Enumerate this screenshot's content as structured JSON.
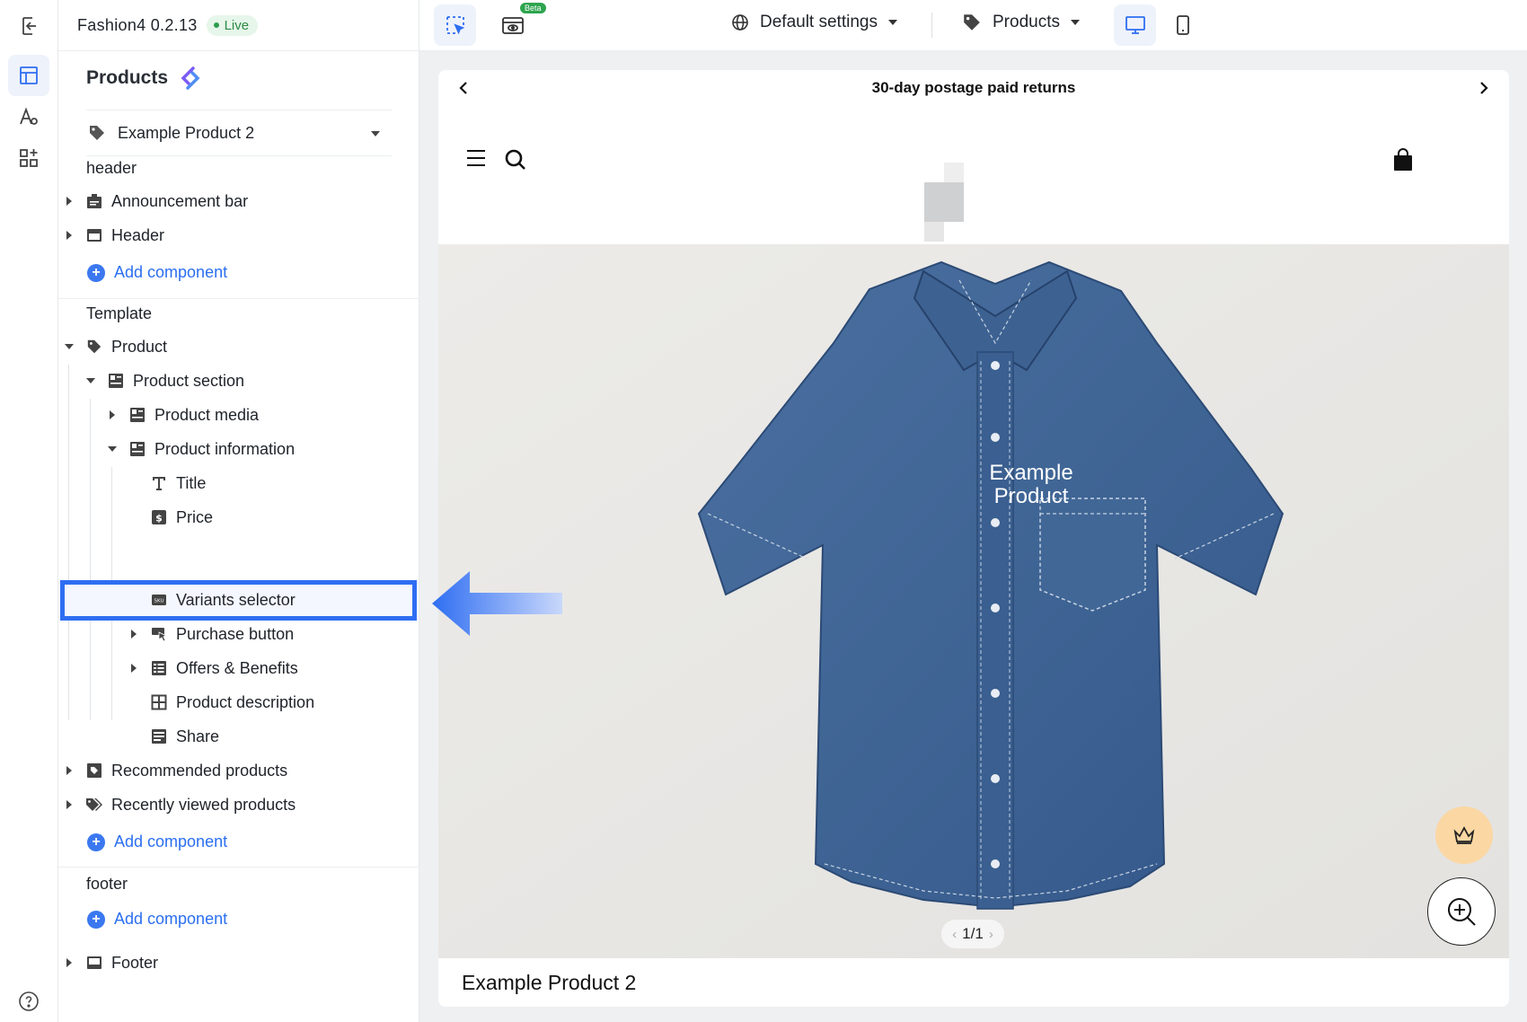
{
  "app": {
    "name": "Fashion4 0.2.13",
    "status": "Live"
  },
  "panel": {
    "title": "Products",
    "selected_product": "Example Product 2"
  },
  "tree": {
    "header_label": "header",
    "announcement_bar": "Announcement bar",
    "header": "Header",
    "add_component": "Add component",
    "template_label": "Template",
    "product": "Product",
    "product_section": "Product section",
    "product_media": "Product media",
    "product_information": "Product information",
    "title": "Title",
    "price": "Price",
    "variants_selector": "Variants selector",
    "purchase_button": "Purchase button",
    "offers_benefits": "Offers & Benefits",
    "product_description": "Product description",
    "share": "Share",
    "recommended_products": "Recommended products",
    "recently_viewed_products": "Recently viewed products",
    "footer_label": "footer",
    "footer": "Footer"
  },
  "topbar": {
    "beta_badge": "Beta",
    "settings_dropdown": "Default settings",
    "page_dropdown": "Products"
  },
  "preview": {
    "announcement": "30-day postage paid returns",
    "shirt_label_line1": "Example",
    "shirt_label_line2": "Product",
    "pager": "1/1",
    "product_title": "Example Product 2"
  },
  "colors": {
    "accent": "#2f6ef2",
    "live_green": "#2c8a45",
    "denim": "#3f6595",
    "fab_orange": "#fbd7a3"
  }
}
